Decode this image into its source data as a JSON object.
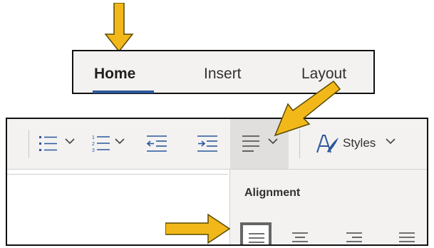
{
  "tabs": {
    "items": [
      {
        "label": "Home",
        "active": true
      },
      {
        "label": "Insert",
        "active": false
      },
      {
        "label": "Layout",
        "active": false
      }
    ]
  },
  "toolbar": {
    "buttons": [
      {
        "icon": "bullets-icon",
        "has_dropdown": true
      },
      {
        "icon": "numbering-icon",
        "has_dropdown": true
      },
      {
        "icon": "decrease-indent-icon",
        "has_dropdown": false
      },
      {
        "icon": "increase-indent-icon",
        "has_dropdown": false
      },
      {
        "icon": "align-icon",
        "has_dropdown": true,
        "pressed": true
      },
      {
        "icon": "styles-icon",
        "has_dropdown": true
      }
    ],
    "styles_label": "Styles"
  },
  "alignment_menu": {
    "title": "Alignment",
    "options": [
      {
        "name": "align-left",
        "selected": true
      },
      {
        "name": "align-center",
        "selected": false
      },
      {
        "name": "align-right",
        "selected": false
      },
      {
        "name": "justify",
        "selected": false
      }
    ]
  },
  "colors": {
    "accent": "#2b579a",
    "arrow_fill": "#f2b81a",
    "arrow_stroke": "#5a4a00",
    "icon_blue": "#2b579a"
  }
}
